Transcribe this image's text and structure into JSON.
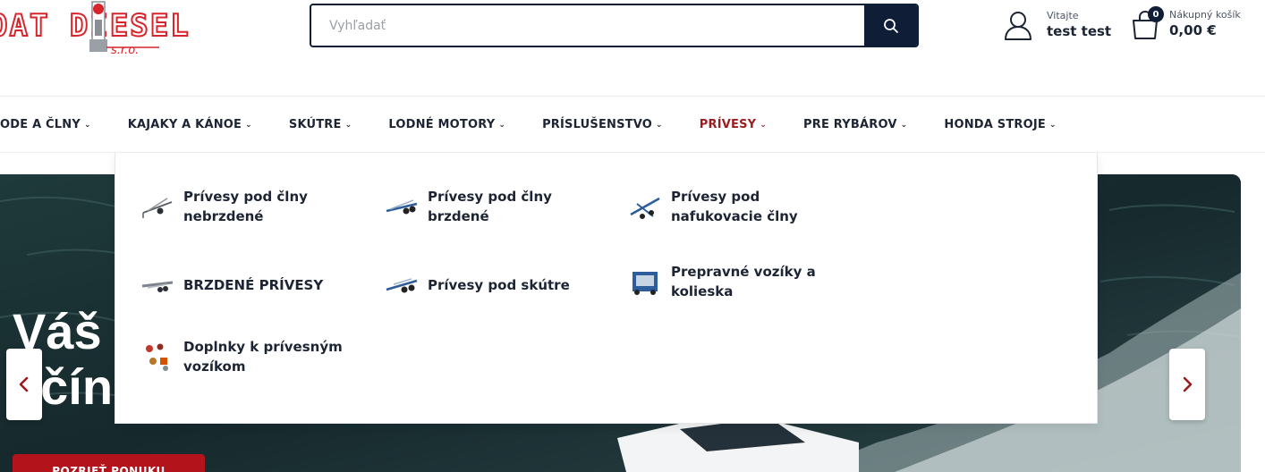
{
  "header": {
    "logo_text": "BOAT DIESEL",
    "logo_sub": "s.r.o.",
    "search_placeholder": "Vyhľadať",
    "account_greeting": "Vitajte",
    "account_name": "test test",
    "cart_label": "Nákupný košík",
    "cart_total": "0,00 €",
    "cart_count": "0"
  },
  "nav": {
    "items": [
      {
        "label": "LODE A ČLNY",
        "active": false
      },
      {
        "label": "KAJAKY A KÁNOE",
        "active": false
      },
      {
        "label": "SKÚTRE",
        "active": false
      },
      {
        "label": "LODNÉ MOTORY",
        "active": false
      },
      {
        "label": "PRÍSLUŠENSTVO",
        "active": false
      },
      {
        "label": "PRÍVESY",
        "active": true
      },
      {
        "label": "PRE RYBÁROV",
        "active": false
      },
      {
        "label": "HONDA STROJE",
        "active": false
      }
    ],
    "chevron_icon": "chevron-down-icon"
  },
  "mega_menu": {
    "items": [
      {
        "label": "Prívesy pod člny nebrzdené",
        "icon": "trailer-unbraked-icon"
      },
      {
        "label": "Prívesy pod člny brzdené",
        "icon": "trailer-braked-icon"
      },
      {
        "label": "Prívesy pod nafukovacie člny",
        "icon": "trailer-inflatable-icon"
      },
      {
        "label": "BRZDENÉ PRÍVESY",
        "icon": "trailer-flat-icon"
      },
      {
        "label": "Prívesy pod skútre",
        "icon": "trailer-jetski-icon"
      },
      {
        "label": "Prepravné vozíky a kolieska",
        "icon": "transport-cart-icon"
      },
      {
        "label": "Doplnky k prívesným vozíkom",
        "icon": "trailer-accessories-icon"
      }
    ]
  },
  "hero": {
    "title_line1": "Váš",
    "title_line2": "ačín",
    "cta_label": "POZRIEŤ PONUKU"
  },
  "colors": {
    "brand_red": "#d8242b",
    "navy": "#0f1e36",
    "active_nav": "#9b1b1f"
  }
}
